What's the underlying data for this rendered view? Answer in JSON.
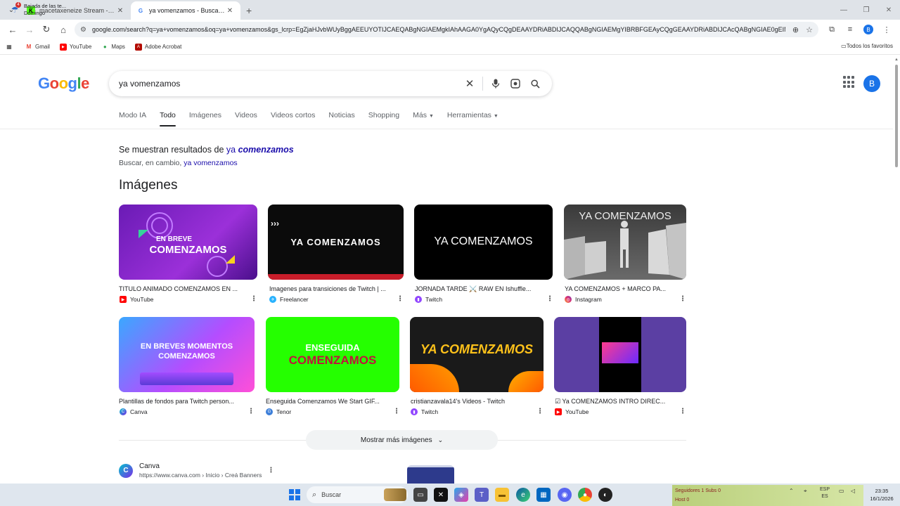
{
  "browser": {
    "tabs": [
      {
        "title": "macetaxeneize Stream - Kick D...",
        "active": false
      },
      {
        "title": "ya vomenzamos - Buscar con G...",
        "active": true
      }
    ],
    "url": "google.com/search?q=ya+vomenzamos&oq=ya+vomenzamos&gs_lcrp=EgZjaHJvbWUyBggAEEUYOTIJCAEQABgNGIAEMgkIAhAAGA0YgAQyCQgDEAAYDRiABDIJCAQQABgNGIAEMgYIBRBFGEAyCQgGEAAYDRiABDIJCAcQABgNGIAE0gEIM...",
    "profile_initial": "B",
    "bookmarks": [
      "Gmail",
      "YouTube",
      "Maps",
      "Adobe Acrobat"
    ],
    "bookmarks_right": "Todos los favoritos"
  },
  "google": {
    "logo": [
      "G",
      "o",
      "o",
      "g",
      "l",
      "e"
    ],
    "query": "ya vomenzamos",
    "avatar_initial": "B",
    "nav_tabs": [
      "Modo IA",
      "Todo",
      "Imágenes",
      "Videos",
      "Videos cortos",
      "Noticias",
      "Shopping",
      "Más",
      "Herramientas"
    ],
    "active_tab": "Todo"
  },
  "spelling": {
    "showing_prefix": "Se muestran resultados de",
    "corrected_plain": "ya",
    "corrected_bold": "comenzamos",
    "instead_prefix": "Buscar, en cambio,",
    "instead_query": "ya vomenzamos"
  },
  "images": {
    "heading": "Imágenes",
    "items": [
      {
        "caption": "TITULO ANIMADO COMENZAMOS EN ...",
        "source": "YouTube",
        "thumb_text": [
          "EN BREVE",
          "COMENZAMOS"
        ]
      },
      {
        "caption": "Imagenes para transiciones de Twitch | ...",
        "source": "Freelancer",
        "thumb_text": [
          "YA COMENZAMOS"
        ]
      },
      {
        "caption": "JORNADA TARDE ⚔️ RAW EN Ishuffle...",
        "source": "Twitch",
        "thumb_text": [
          "YA COMENZAMOS"
        ]
      },
      {
        "caption": "YA COMENZAMOS + MARCO PA...",
        "source": "Instagram",
        "thumb_text": [
          "YA COMENZAMOS"
        ]
      },
      {
        "caption": "Plantillas de fondos para Twitch person...",
        "source": "Canva",
        "thumb_text": [
          "EN BREVES MOMENTOS",
          "COMENZAMOS"
        ]
      },
      {
        "caption": "Enseguida Comenzamos We Start GIF...",
        "source": "Tenor",
        "thumb_text": [
          "ENSEGUIDA",
          "COMENZAMOS"
        ]
      },
      {
        "caption": "cristianzavala14's Videos - Twitch",
        "source": "Twitch",
        "thumb_text": [
          "YA COMENZAMOS"
        ]
      },
      {
        "caption": "☑ Ya COMENZAMOS INTRO DIREC...",
        "source": "YouTube",
        "thumb_text": []
      }
    ],
    "more_button": "Mostrar más imágenes"
  },
  "web_result": {
    "site_name": "Canva",
    "breadcrumb": "https://www.canva.com › Inicio › Creá Banners"
  },
  "taskbar": {
    "weather_title": "Bajada de las te...",
    "weather_sub": "Domingo",
    "weather_badge": "4",
    "search_label": "Buscar",
    "lang_top": "ESP",
    "lang_bottom": "ES",
    "time": "23:35",
    "date": "16/1/2026",
    "stream_line1": "Seguidores 1 Subs 0",
    "stream_line2": "Host 0"
  },
  "colors": {
    "google_blue": "#4285f4",
    "google_red": "#ea4335",
    "google_yellow": "#fbbc05",
    "google_green": "#34a853",
    "link": "#1a0dab"
  }
}
